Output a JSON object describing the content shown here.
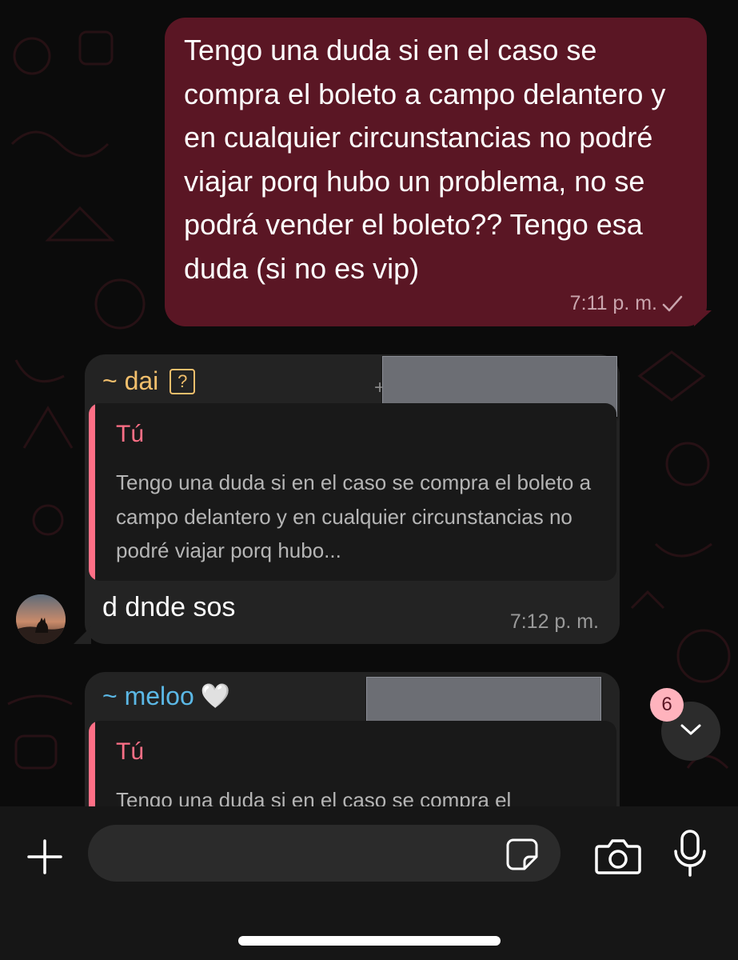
{
  "outgoing": {
    "text": "Tengo una duda si en el caso se compra el boleto a campo delantero y en cualquier circunstancias no podré viajar porq hubo un problema, no se podrá vender el boleto?? Tengo esa duda (si no es vip)",
    "time": "7:11 p. m."
  },
  "incoming": [
    {
      "sender": "~ dai",
      "sender_badge": "?",
      "sender_extra": "+",
      "reply_to": {
        "name": "Tú",
        "text": "Tengo una duda si en el caso se compra el boleto a campo delantero y en cualquier circunstancias no podré viajar porq hubo..."
      },
      "text": "d dnde sos",
      "time": "7:12 p. m."
    },
    {
      "sender": "~ meloo",
      "sender_badge": "🤍",
      "reply_to": {
        "name": "Tú",
        "text": "Tengo una duda si en el caso se compra el"
      }
    }
  ],
  "scroll": {
    "unread_count": "6",
    "icon": "chevron-down-icon"
  },
  "composer": {
    "placeholder": "",
    "icons": [
      "plus-icon",
      "sticker-icon",
      "camera-icon",
      "microphone-icon"
    ]
  },
  "colors": {
    "outgoing_bubble": "#5a1624",
    "incoming_bubble": "#232323",
    "quote_accent": "#ff6f86",
    "sender_dai": "#f2bf6c",
    "sender_meloo": "#5bb8e6"
  }
}
